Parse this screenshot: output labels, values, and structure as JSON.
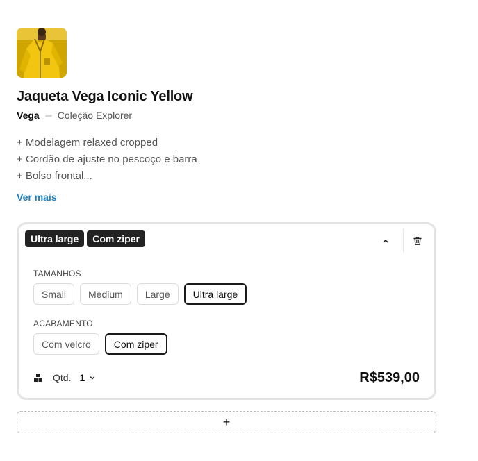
{
  "product": {
    "image_icon": "jacket-thumbnail",
    "title": "Jaqueta Vega Iconic Yellow",
    "brand": "Vega",
    "collection": "Coleção Explorer",
    "features": [
      "+ Modelagem relaxed cropped",
      "+ Cordão de ajuste no pescoço e barra",
      "+ Bolso frontal..."
    ],
    "see_more_label": "Ver mais",
    "accent_color": "#1d7fbf"
  },
  "variant": {
    "selected_tags": [
      "Ultra large",
      "Com ziper"
    ],
    "sizes": {
      "label": "TAMANHOS",
      "options": [
        "Small",
        "Medium",
        "Large",
        "Ultra large"
      ],
      "selected": "Ultra large"
    },
    "finish": {
      "label": "ACABAMENTO",
      "options": [
        "Com velcro",
        "Com ziper"
      ],
      "selected": "Com ziper"
    },
    "quantity": {
      "label": "Qtd.",
      "value": "1"
    },
    "price": "R$539,00"
  },
  "add_button_symbol": "+"
}
